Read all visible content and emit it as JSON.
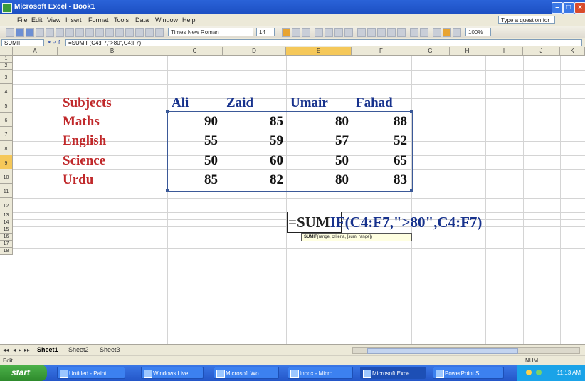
{
  "window": {
    "title": "Microsoft Excel - Book1"
  },
  "menu": [
    "File",
    "Edit",
    "View",
    "Insert",
    "Format",
    "Tools",
    "Data",
    "Window",
    "Help"
  ],
  "ask_box": "Type a question for help",
  "toolbar": {
    "font_name": "Times New Roman",
    "font_size": "14",
    "zoom": "100%"
  },
  "formula_bar": {
    "name_box": "SUMIF",
    "formula": "=SUMIF(C4:F7,\">80\",C4:F7)"
  },
  "columns": [
    "A",
    "B",
    "C",
    "D",
    "E",
    "F",
    "G",
    "H",
    "I",
    "J",
    "K"
  ],
  "rows": [
    "1",
    "2",
    "3",
    "4",
    "5",
    "6",
    "7",
    "8",
    "9",
    "10",
    "11",
    "12",
    "13",
    "14",
    "15",
    "16",
    "17",
    "18"
  ],
  "table": {
    "header_label": "Subjects",
    "names": [
      "Ali",
      "Zaid",
      "Umair",
      "Fahad"
    ],
    "rows": [
      {
        "subject": "Maths",
        "values": [
          "90",
          "85",
          "80",
          "88"
        ]
      },
      {
        "subject": "English",
        "values": [
          "55",
          "59",
          "57",
          "52"
        ]
      },
      {
        "subject": "Science",
        "values": [
          "50",
          "60",
          "50",
          "65"
        ]
      },
      {
        "subject": "Urdu",
        "values": [
          "85",
          "82",
          "80",
          "83"
        ]
      }
    ]
  },
  "edit": {
    "prefix": "=SUM",
    "rest": "IF(C4:F7,\">80\",C4:F7)",
    "tooltip_fn": "SUMIF",
    "tooltip_args": "(range, criteria, [sum_range])"
  },
  "sheets": [
    "Sheet1",
    "Sheet2",
    "Sheet3"
  ],
  "status": {
    "mode": "Edit",
    "num": "NUM"
  },
  "taskbar": {
    "start": "start",
    "tasks": [
      "Untitled - Paint",
      "Windows Live...",
      "Microsoft Wo...",
      "Inbox - Micro...",
      "Microsoft Exce...",
      "PowerPoint Sl..."
    ],
    "clock": "11:13 AM"
  }
}
